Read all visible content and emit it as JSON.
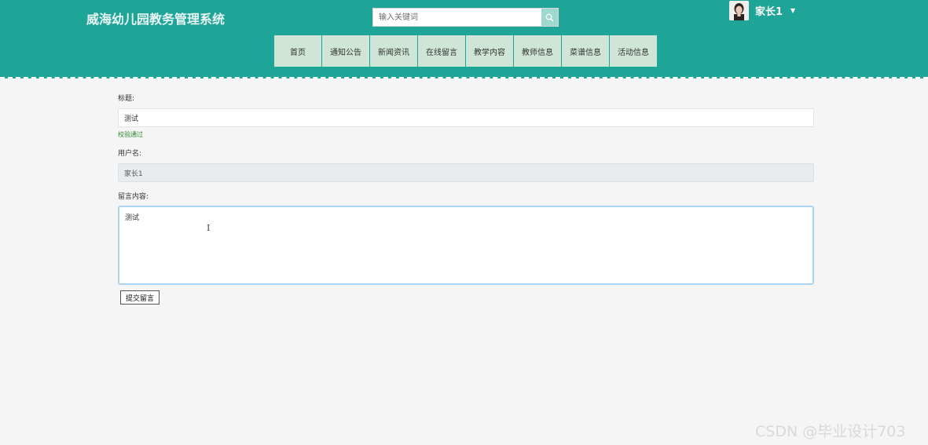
{
  "header": {
    "site_title": "威海幼儿园教务管理系统",
    "search": {
      "placeholder": "输入关键词",
      "value": ""
    },
    "user": {
      "name": "家长1"
    },
    "nav": [
      "首页",
      "通知公告",
      "新闻资讯",
      "在线留言",
      "教学内容",
      "教师信息",
      "菜谱信息",
      "活动信息"
    ]
  },
  "form": {
    "title_label": "标题:",
    "title_value": "测试",
    "title_validation": "校验通过",
    "username_label": "用户名:",
    "username_value": "家长1",
    "content_label": "留言内容:",
    "content_value": "测试",
    "submit_label": "提交留言"
  },
  "watermark": "CSDN @毕业设计703",
  "colors": {
    "header_bg": "#1ea597",
    "nav_bg": "#cfe5d6",
    "page_bg": "#f5f5f5",
    "textarea_focus": "#a9d4f2"
  },
  "icons": {
    "search": "search-icon",
    "caret": "caret-down-icon"
  }
}
